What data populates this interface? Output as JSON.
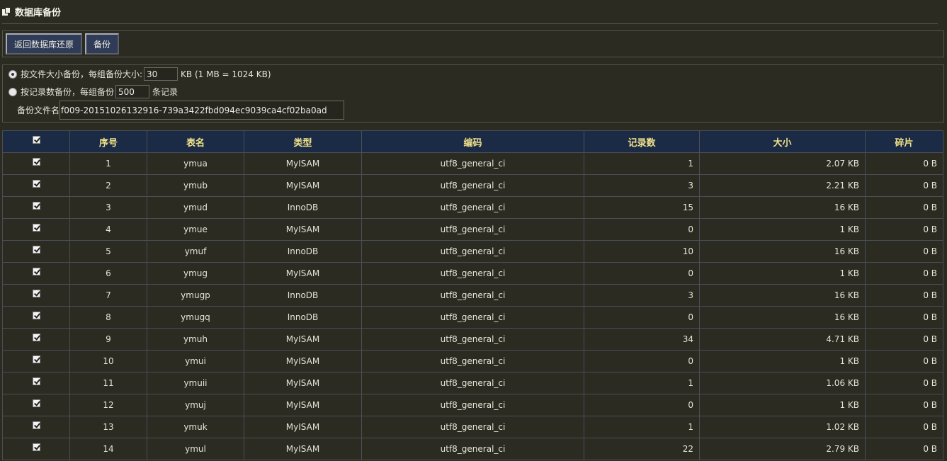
{
  "page": {
    "title": "数据库备份"
  },
  "toolbar": {
    "restore_label": "返回数据库还原",
    "backup_label": "备份"
  },
  "options": {
    "by_size_label": "按文件大小备份，每组备份大小:",
    "size_value": "30",
    "size_unit": "KB (1 MB = 1024 KB)",
    "by_records_label": "按记录数备份，每组备份",
    "records_value": "500",
    "records_unit": "条记录",
    "filename_label": "备份文件名",
    "filename_value": "f009-20151026132916-739a3422fbd094ec9039ca4cf02ba0ad",
    "selected_mode": "by_size"
  },
  "table": {
    "headers": {
      "index": "序号",
      "name": "表名",
      "type": "类型",
      "charset": "编码",
      "records": "记录数",
      "size": "大小",
      "overhead": "碎片"
    },
    "rows": [
      {
        "index": "1",
        "name": "ymua",
        "type": "MyISAM",
        "charset": "utf8_general_ci",
        "records": "1",
        "size": "2.07 KB",
        "overhead": "0 B"
      },
      {
        "index": "2",
        "name": "ymub",
        "type": "MyISAM",
        "charset": "utf8_general_ci",
        "records": "3",
        "size": "2.21 KB",
        "overhead": "0 B"
      },
      {
        "index": "3",
        "name": "ymud",
        "type": "InnoDB",
        "charset": "utf8_general_ci",
        "records": "15",
        "size": "16 KB",
        "overhead": "0 B"
      },
      {
        "index": "4",
        "name": "ymue",
        "type": "MyISAM",
        "charset": "utf8_general_ci",
        "records": "0",
        "size": "1 KB",
        "overhead": "0 B"
      },
      {
        "index": "5",
        "name": "ymuf",
        "type": "InnoDB",
        "charset": "utf8_general_ci",
        "records": "10",
        "size": "16 KB",
        "overhead": "0 B"
      },
      {
        "index": "6",
        "name": "ymug",
        "type": "MyISAM",
        "charset": "utf8_general_ci",
        "records": "0",
        "size": "1 KB",
        "overhead": "0 B"
      },
      {
        "index": "7",
        "name": "ymugp",
        "type": "InnoDB",
        "charset": "utf8_general_ci",
        "records": "3",
        "size": "16 KB",
        "overhead": "0 B"
      },
      {
        "index": "8",
        "name": "ymugq",
        "type": "InnoDB",
        "charset": "utf8_general_ci",
        "records": "0",
        "size": "16 KB",
        "overhead": "0 B"
      },
      {
        "index": "9",
        "name": "ymuh",
        "type": "MyISAM",
        "charset": "utf8_general_ci",
        "records": "34",
        "size": "4.71 KB",
        "overhead": "0 B"
      },
      {
        "index": "10",
        "name": "ymui",
        "type": "MyISAM",
        "charset": "utf8_general_ci",
        "records": "0",
        "size": "1 KB",
        "overhead": "0 B"
      },
      {
        "index": "11",
        "name": "ymuii",
        "type": "MyISAM",
        "charset": "utf8_general_ci",
        "records": "1",
        "size": "1.06 KB",
        "overhead": "0 B"
      },
      {
        "index": "12",
        "name": "ymuj",
        "type": "MyISAM",
        "charset": "utf8_general_ci",
        "records": "0",
        "size": "1 KB",
        "overhead": "0 B"
      },
      {
        "index": "13",
        "name": "ymuk",
        "type": "MyISAM",
        "charset": "utf8_general_ci",
        "records": "1",
        "size": "1.02 KB",
        "overhead": "0 B"
      },
      {
        "index": "14",
        "name": "ymul",
        "type": "MyISAM",
        "charset": "utf8_general_ci",
        "records": "22",
        "size": "2.79 KB",
        "overhead": "0 B"
      }
    ]
  }
}
